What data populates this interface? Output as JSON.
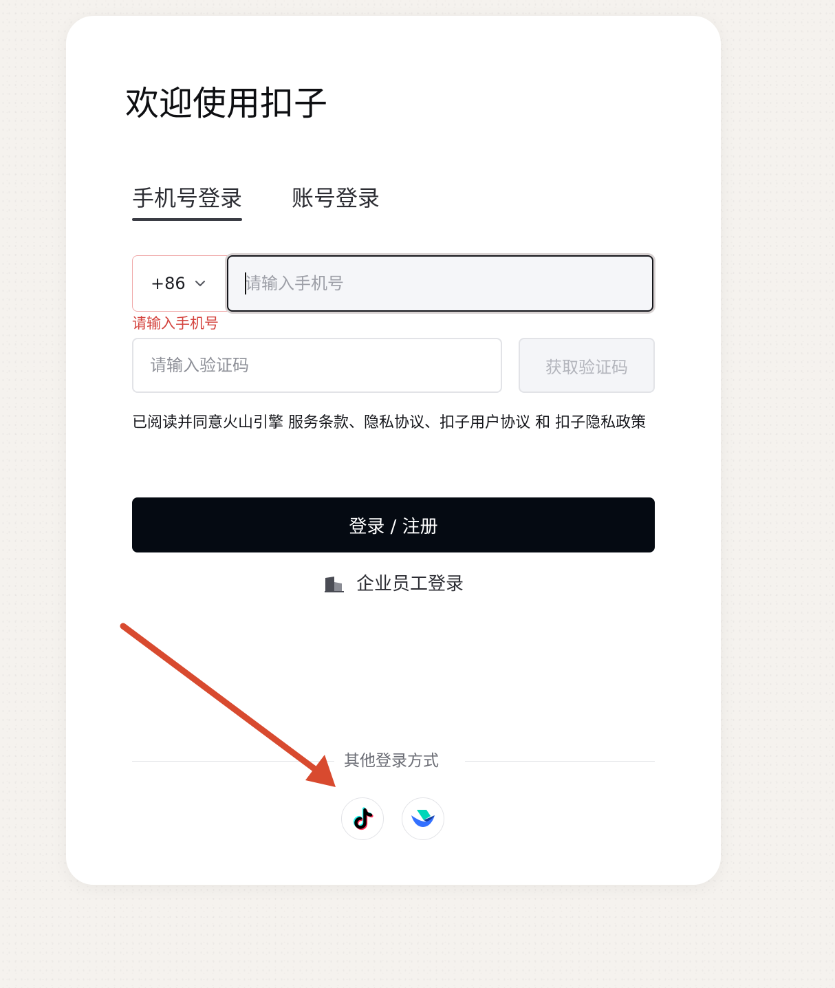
{
  "card": {
    "title": "欢迎使用扣子"
  },
  "tabs": [
    {
      "label": "手机号登录",
      "active": true
    },
    {
      "label": "账号登录",
      "active": false
    }
  ],
  "phone": {
    "country_code": "+86",
    "placeholder": "请输入手机号",
    "value": "",
    "error": "请输入手机号"
  },
  "verification": {
    "placeholder": "请输入验证码",
    "value": "",
    "get_code_label": "获取验证码"
  },
  "agreement": {
    "prefix": "已阅读并同意火山引擎 ",
    "service_terms": "服务条款",
    "sep1": "、",
    "privacy": "隐私协议",
    "sep2": "、",
    "user_agreement": "扣子用户协议",
    "and": " 和 ",
    "privacy_policy": "扣子隐私政策"
  },
  "login_button": "登录 / 注册",
  "enterprise_login": {
    "label": "企业员工登录",
    "icon": "building-icon"
  },
  "other_login": {
    "label": "其他登录方式",
    "providers": [
      {
        "name": "douyin",
        "icon": "douyin-icon"
      },
      {
        "name": "feishu",
        "icon": "feishu-icon"
      }
    ]
  },
  "colors": {
    "primary_button": "#050a12",
    "error": "#d4443f",
    "annotation_arrow": "#d84a2f",
    "page_background": "#f5f2ee"
  }
}
